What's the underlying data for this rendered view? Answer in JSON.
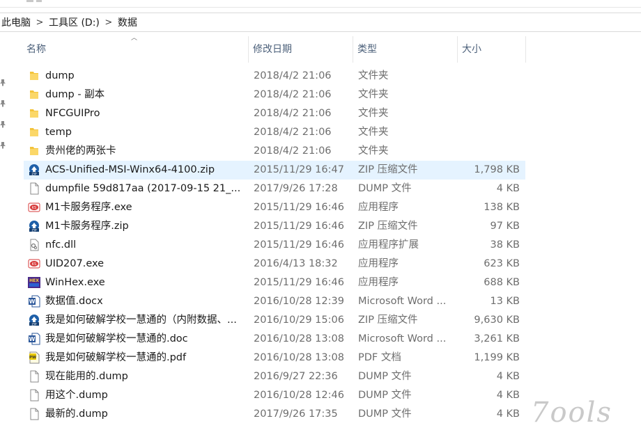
{
  "breadcrumb": {
    "items": [
      "此电脑",
      "工具区 (D:)",
      "数据"
    ],
    "separator": ">"
  },
  "columns": {
    "name": "名称",
    "date": "修改日期",
    "type": "类型",
    "size": "大小"
  },
  "files": [
    {
      "name": "dump",
      "date": "2018/4/2 21:06",
      "type": "文件夹",
      "size": "",
      "icon": "folder-icon"
    },
    {
      "name": "dump - 副本",
      "date": "2018/4/2 21:06",
      "type": "文件夹",
      "size": "",
      "icon": "folder-icon"
    },
    {
      "name": "NFCGUIPro",
      "date": "2018/4/2 21:06",
      "type": "文件夹",
      "size": "",
      "icon": "folder-icon"
    },
    {
      "name": "temp",
      "date": "2018/4/2 21:06",
      "type": "文件夹",
      "size": "",
      "icon": "folder-icon"
    },
    {
      "name": "贵州佬的两张卡",
      "date": "2018/4/2 21:06",
      "type": "文件夹",
      "size": "",
      "icon": "folder-icon"
    },
    {
      "name": "ACS-Unified-MSI-Winx64-4100.zip",
      "date": "2015/11/29 16:47",
      "type": "ZIP 压缩文件",
      "size": "1,798 KB",
      "icon": "zip-icon",
      "selected": true
    },
    {
      "name": "dumpfile 59d817aa (2017-09-15 21_...",
      "date": "2017/9/26 17:28",
      "type": "DUMP 文件",
      "size": "4 KB",
      "icon": "blank-file-icon"
    },
    {
      "name": "M1卡服务程序.exe",
      "date": "2015/11/29 16:46",
      "type": "应用程序",
      "size": "138 KB",
      "icon": "exe-red-icon"
    },
    {
      "name": "M1卡服务程序.zip",
      "date": "2015/11/29 16:46",
      "type": "ZIP 压缩文件",
      "size": "97 KB",
      "icon": "zip-icon"
    },
    {
      "name": "nfc.dll",
      "date": "2015/11/29 16:46",
      "type": "应用程序扩展",
      "size": "38 KB",
      "icon": "dll-icon"
    },
    {
      "name": "UID207.exe",
      "date": "2016/4/13 18:32",
      "type": "应用程序",
      "size": "623 KB",
      "icon": "exe-red-icon"
    },
    {
      "name": "WinHex.exe",
      "date": "2015/11/29 16:46",
      "type": "应用程序",
      "size": "688 KB",
      "icon": "winhex-icon"
    },
    {
      "name": "数据值.docx",
      "date": "2016/10/28 12:39",
      "type": "Microsoft Word ...",
      "size": "13 KB",
      "icon": "word-icon"
    },
    {
      "name": "我是如何破解学校一慧通的（内附数据、...",
      "date": "2016/10/29 15:06",
      "type": "ZIP 压缩文件",
      "size": "9,630 KB",
      "icon": "zip-icon"
    },
    {
      "name": "我是如何破解学校一慧通的.doc",
      "date": "2016/10/28 13:08",
      "type": "Microsoft Word ...",
      "size": "3,261 KB",
      "icon": "word-icon"
    },
    {
      "name": "我是如何破解学校一慧通的.pdf",
      "date": "2016/10/28 13:08",
      "type": "PDF 文档",
      "size": "1,199 KB",
      "icon": "pdf-icon"
    },
    {
      "name": "现在能用的.dump",
      "date": "2016/9/27 22:36",
      "type": "DUMP 文件",
      "size": "4 KB",
      "icon": "blank-file-icon"
    },
    {
      "name": "用这个.dump",
      "date": "2016/10/28 12:46",
      "type": "DUMP 文件",
      "size": "4 KB",
      "icon": "blank-file-icon"
    },
    {
      "name": "最新的.dump",
      "date": "2017/9/26 17:35",
      "type": "DUMP 文件",
      "size": "4 KB",
      "icon": "blank-file-icon"
    }
  ],
  "watermark": {
    "text": "7ools"
  },
  "colors": {
    "selection": "#e5f3ff",
    "header_text": "#4c607a",
    "folder": "#f3c33b",
    "zip_blue": "#1e5fa8",
    "exe_red": "#d73a3a",
    "word_blue": "#2b579a"
  }
}
